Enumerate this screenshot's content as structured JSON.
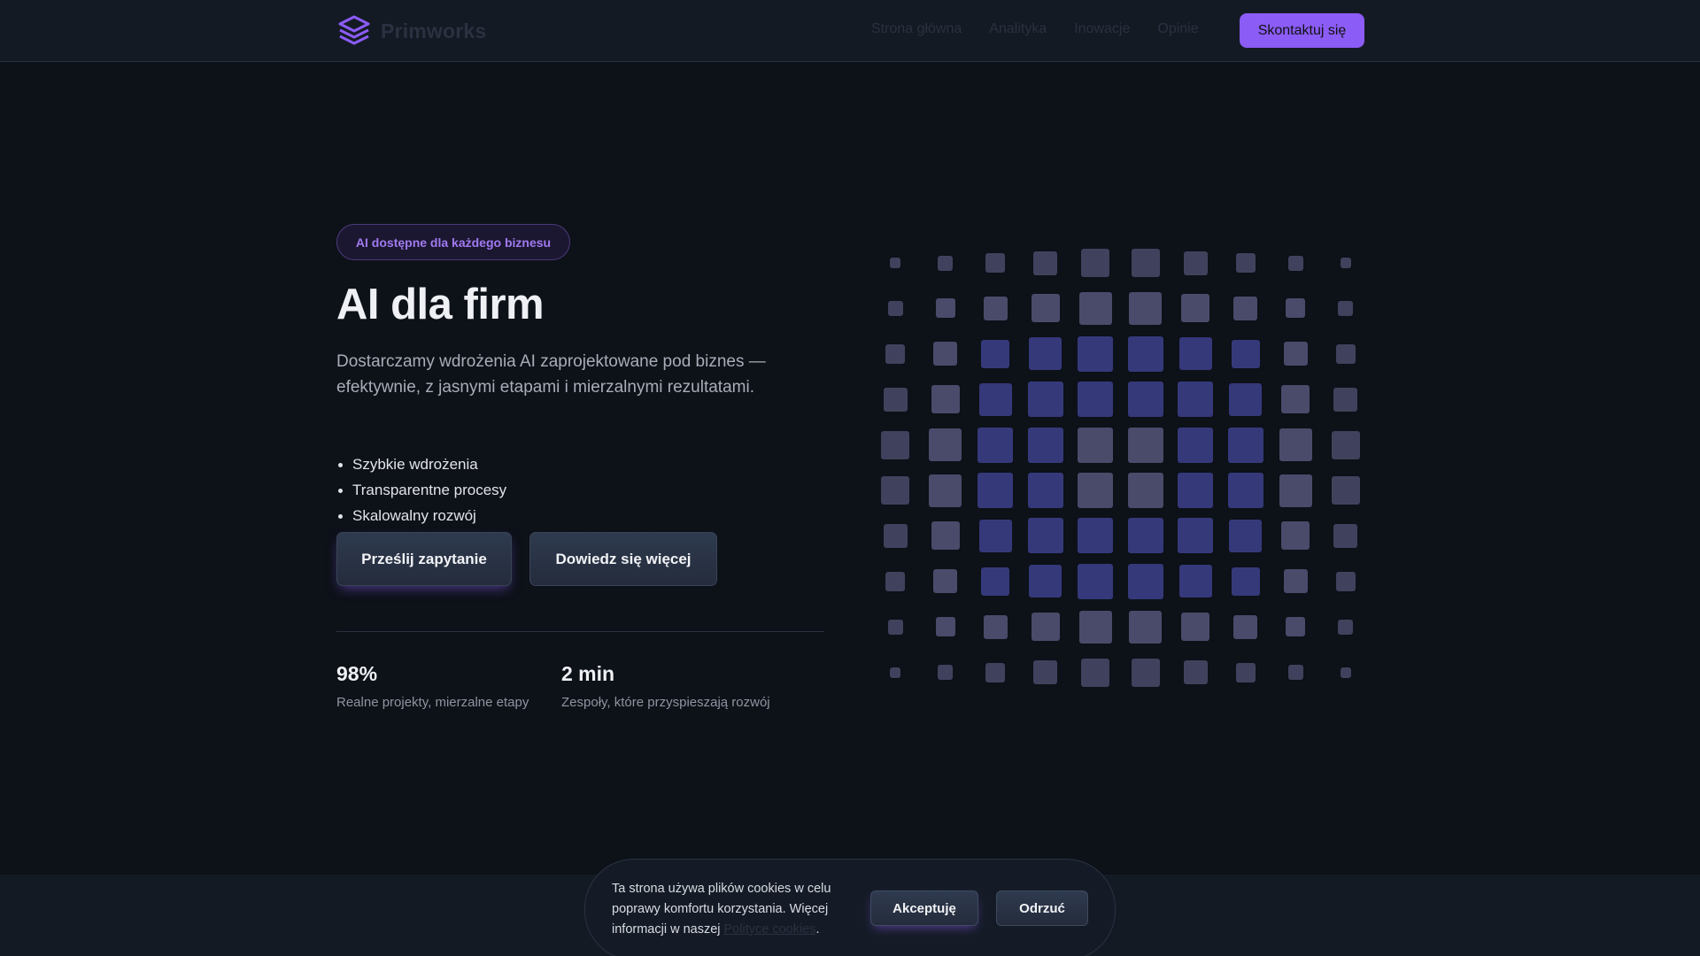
{
  "header": {
    "brand": "Primworks",
    "nav": [
      "Strona główna",
      "Analityka",
      "Inowacje",
      "Opinie"
    ],
    "cta_label": "Skontaktuj się"
  },
  "hero": {
    "badge": "AI dostępne dla każdego biznesu",
    "title": "AI dla firm",
    "description": "Dostarczamy wdrożenia AI zaprojektowane pod biznes — efektywnie, z jasnymi etapami i mierzalnymi rezultatami.",
    "bullets": [
      "Szybkie wdrożenia",
      "Transparentne procesy",
      "Skalowalny rozwój"
    ],
    "primary_button": "Prześlij zapytanie",
    "secondary_button": "Dowiedz się więcej"
  },
  "stats": [
    {
      "value": "98%",
      "label": "Realne projekty, mierzalne etapy"
    },
    {
      "value": "2 min",
      "label": "Zespoły, które przyspieszają rozwój"
    }
  ],
  "cookie": {
    "text_before": "Ta strona używa plików cookies w celu poprawy komfortu korzystania. Więcej informacji w naszej ",
    "link_text": "Polityce cookies",
    "text_after": ".",
    "accept": "Akceptuję",
    "reject": "Odrzuć"
  },
  "colors": {
    "accent": "#8b5cf6",
    "background": "#0d1118",
    "surface": "#141a24",
    "grid_cell_blue": "#35397a",
    "grid_cell_gray": "#4a4b6a"
  },
  "icons": {
    "logo": "stacked-layers-icon"
  }
}
